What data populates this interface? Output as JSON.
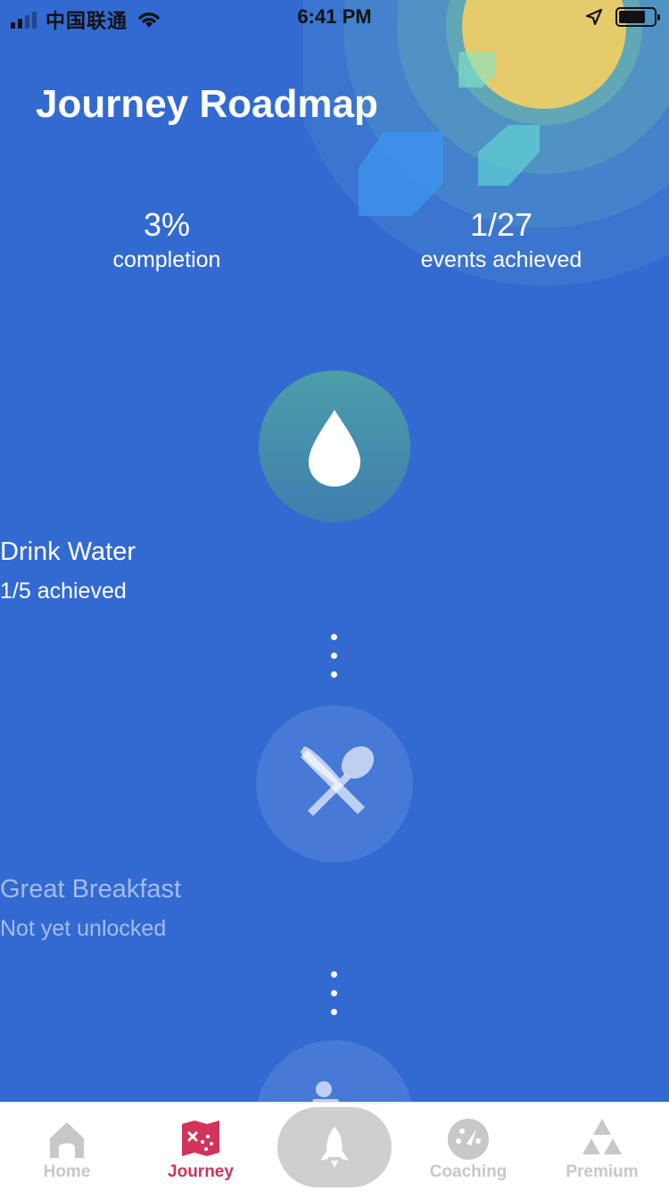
{
  "status_bar": {
    "carrier": "中国联通",
    "time": "6:41 PM"
  },
  "header": {
    "title": "Journey Roadmap"
  },
  "stats": {
    "completion_value": "3%",
    "completion_label": "completion",
    "events_value": "1/27",
    "events_label": "events achieved"
  },
  "milestones": [
    {
      "icon": "water-drop-icon",
      "title": "Drink Water",
      "subtitle": "1/5 achieved",
      "state": "active"
    },
    {
      "icon": "fork-spoon-icon",
      "title": "Great Breakfast",
      "subtitle": "Not yet unlocked",
      "state": "locked"
    },
    {
      "icon": "person-icon",
      "state": "locked"
    }
  ],
  "tab_bar": {
    "tabs": [
      {
        "label": "Home",
        "icon": "home-icon",
        "active": false
      },
      {
        "label": "Journey",
        "icon": "journey-map-icon",
        "active": true
      },
      {
        "label": "",
        "icon": "rocket-icon",
        "active": false
      },
      {
        "label": "Coaching",
        "icon": "gauge-icon",
        "active": false
      },
      {
        "label": "Premium",
        "icon": "triangles-icon",
        "active": false
      }
    ]
  },
  "colors": {
    "background": "#336AD2",
    "active_tab": "#D2335C",
    "inactive_tab": "#C8C8C8"
  }
}
